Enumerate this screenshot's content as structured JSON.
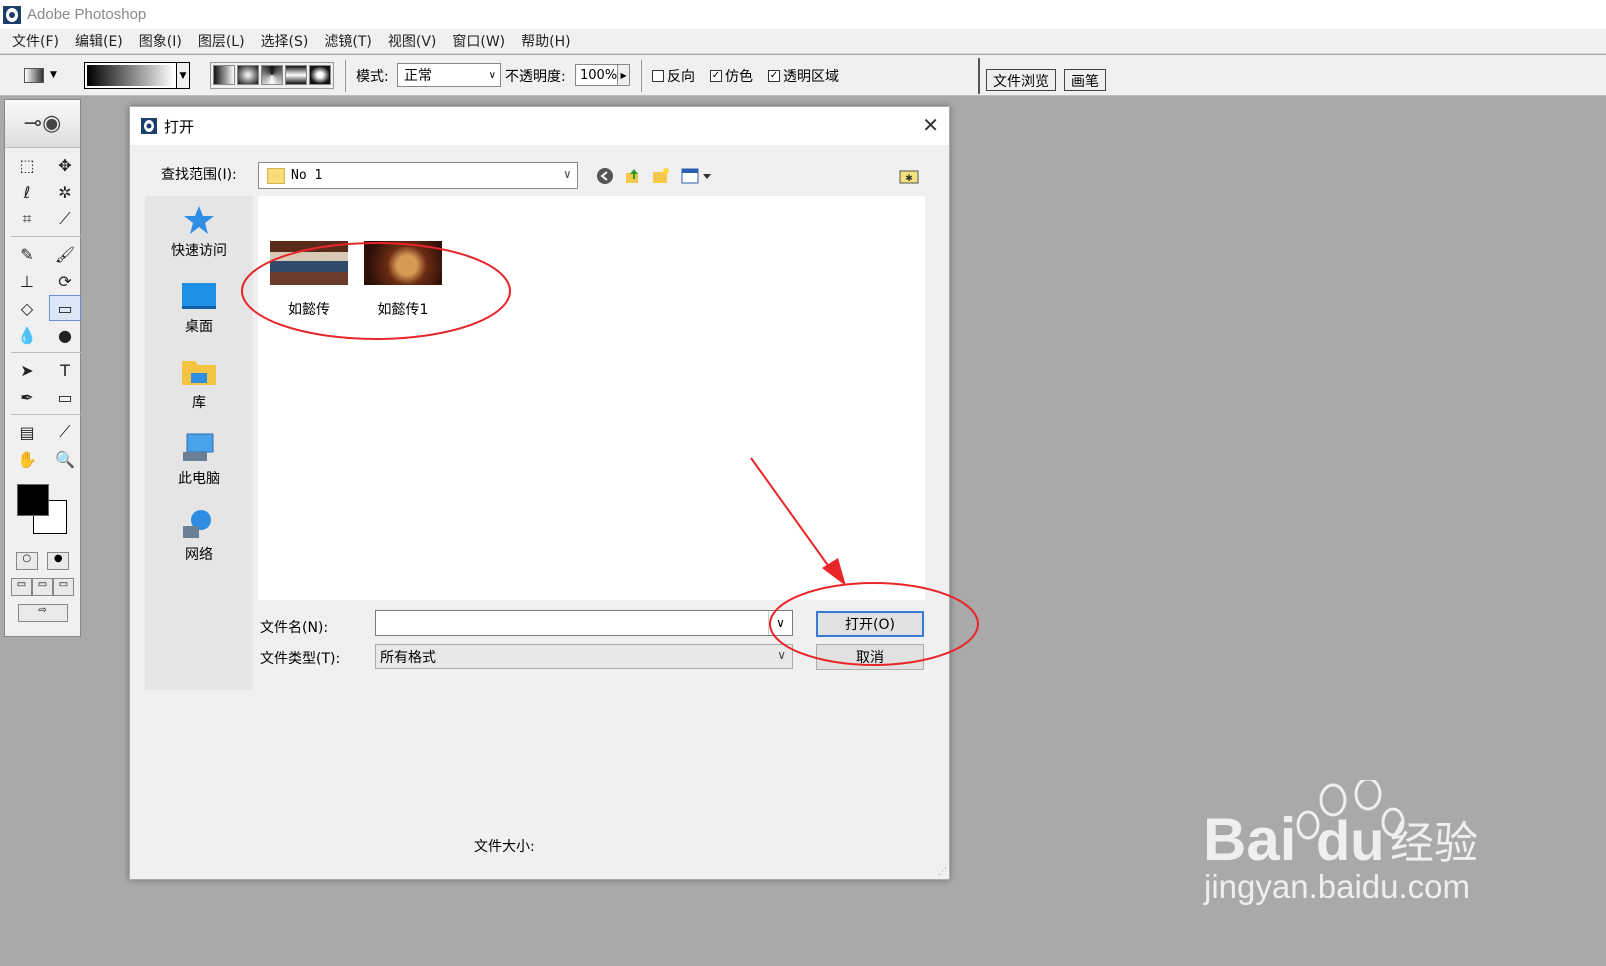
{
  "app": {
    "title": "Adobe Photoshop"
  },
  "menu": [
    "文件(F)",
    "编辑(E)",
    "图象(I)",
    "图层(L)",
    "选择(S)",
    "滤镜(T)",
    "视图(V)",
    "窗口(W)",
    "帮助(H)"
  ],
  "options": {
    "mode_label": "模式:",
    "mode_value": "正常",
    "opacity_label": "不透明度:",
    "opacity_value": "100%",
    "reverse_label": "反向",
    "dither_label": "仿色",
    "transparency_label": "透明区域",
    "reverse_checked": false,
    "dither_checked": true,
    "transparency_checked": true
  },
  "palette_well": {
    "tabs": [
      "文件浏览",
      "画笔"
    ]
  },
  "dialog": {
    "title": "打开",
    "lookin_label": "查找范围(I):",
    "lookin_value": "No 1",
    "places": [
      "快速访问",
      "桌面",
      "库",
      "此电脑",
      "网络"
    ],
    "files": [
      "如懿传",
      "如懿传1"
    ],
    "filename_label": "文件名(N):",
    "filename_value": "",
    "filetype_label": "文件类型(T):",
    "filetype_value": "所有格式",
    "open_button": "打开(O)",
    "cancel_button": "取消",
    "filesize_label": "文件大小:"
  },
  "watermark": {
    "logo": "Bai du 经验",
    "url": "jingyan.baidu.com"
  },
  "colors": {
    "accent": "#3b7ad6",
    "annotation": "#e8262a",
    "workspace": "#a9a9a9"
  }
}
